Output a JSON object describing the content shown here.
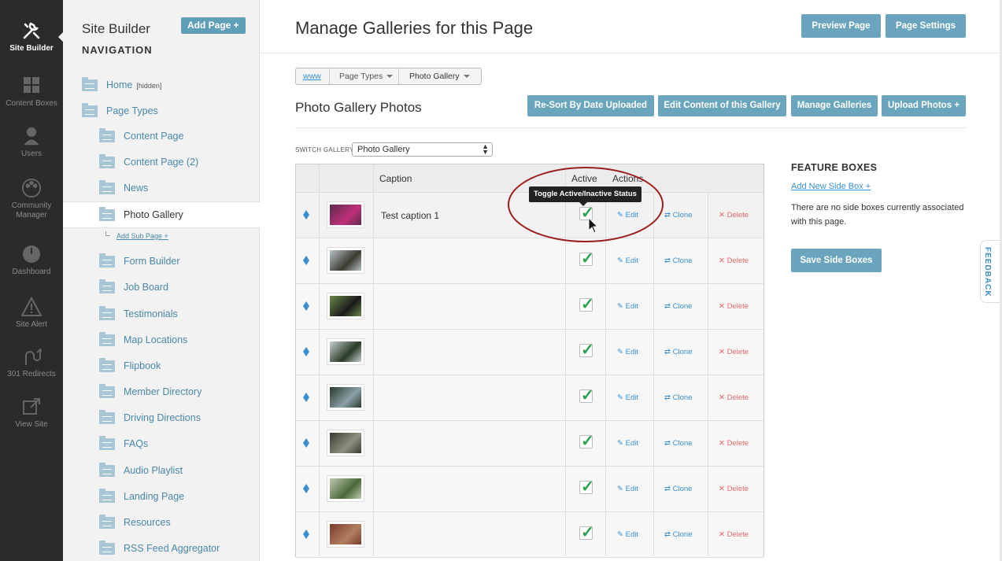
{
  "rail": {
    "items": [
      {
        "label": "Site Builder",
        "icon": "tools-icon"
      },
      {
        "label": "Content Boxes",
        "icon": "grid-icon"
      },
      {
        "label": "Users",
        "icon": "user-icon"
      },
      {
        "label": "Community Manager",
        "icon": "community-icon"
      },
      {
        "label": "Dashboard",
        "icon": "dashboard-icon"
      },
      {
        "label": "Site Alert",
        "icon": "alert-icon"
      },
      {
        "label": "301 Redirects",
        "icon": "redirect-icon"
      },
      {
        "label": "View Site",
        "icon": "external-link-icon"
      }
    ]
  },
  "nav": {
    "title": "Site Builder",
    "subtitle": "NAVIGATION",
    "add_page": "Add Page +",
    "hidden_tag": "[hidden]",
    "add_sub_page": "Add Sub Page +",
    "items": [
      {
        "label": "Home"
      },
      {
        "label": "Page Types"
      },
      {
        "label": "Content Page"
      },
      {
        "label": "Content Page (2)"
      },
      {
        "label": "News"
      },
      {
        "label": "Photo Gallery"
      },
      {
        "label": "Form Builder"
      },
      {
        "label": "Job Board"
      },
      {
        "label": "Testimonials"
      },
      {
        "label": "Map Locations"
      },
      {
        "label": "Flipbook"
      },
      {
        "label": "Member Directory"
      },
      {
        "label": "Driving Directions"
      },
      {
        "label": "FAQs"
      },
      {
        "label": "Audio Playlist"
      },
      {
        "label": "Landing Page"
      },
      {
        "label": "Resources"
      },
      {
        "label": "RSS Feed Aggregator"
      }
    ]
  },
  "header": {
    "title": "Manage Galleries for this Page",
    "preview_page": "Preview Page",
    "page_settings": "Page Settings"
  },
  "breadcrumb": {
    "root": "www",
    "level1": "Page Types",
    "level2": "Photo Gallery"
  },
  "section": {
    "title": "Photo Gallery Photos",
    "resort": "Re-Sort By Date Uploaded",
    "edit_content": "Edit Content of this Gallery",
    "manage_galleries": "Manage Galleries",
    "upload_photos": "Upload Photos +"
  },
  "switch_gallery": {
    "label": "SWITCH GALLERY:",
    "selected": "Photo Gallery"
  },
  "table": {
    "headers": {
      "caption": "Caption",
      "active": "Active",
      "actions": "Actions"
    },
    "actions": {
      "edit": "Edit",
      "clone": "Clone",
      "delete": "Delete"
    },
    "rows": [
      {
        "caption": "Test caption 1",
        "active": true,
        "thumb_colors": [
          "#5a2a4a",
          "#c0307a"
        ]
      },
      {
        "caption": "",
        "active": true,
        "thumb_colors": [
          "#b8c4c8",
          "#3a3a30"
        ]
      },
      {
        "caption": "",
        "active": true,
        "thumb_colors": [
          "#6a8a4a",
          "#1a1a1a"
        ]
      },
      {
        "caption": "",
        "active": true,
        "thumb_colors": [
          "#c8d0d0",
          "#2a3a28"
        ]
      },
      {
        "caption": "",
        "active": true,
        "thumb_colors": [
          "#2a3a2a",
          "#8aa0a8"
        ]
      },
      {
        "caption": "",
        "active": true,
        "thumb_colors": [
          "#3a3a32",
          "#909080"
        ]
      },
      {
        "caption": "",
        "active": true,
        "thumb_colors": [
          "#c0c8b0",
          "#4a6a3a"
        ]
      },
      {
        "caption": "",
        "active": true,
        "thumb_colors": [
          "#7a3a2a",
          "#b08060"
        ]
      }
    ],
    "tooltip": "Toggle Active/Inactive Status"
  },
  "feature_boxes": {
    "title": "FEATURE BOXES",
    "add_link": "Add New Side Box +",
    "empty_text": "There are no side boxes currently associated with this page.",
    "save_button": "Save Side Boxes"
  },
  "feedback": "FEEDBACK",
  "colors": {
    "rail": "#2b2b2b",
    "accent": "#6aa5bd",
    "link": "#3a8fd1",
    "check": "#2aa050",
    "delete": "#e06a6a"
  }
}
